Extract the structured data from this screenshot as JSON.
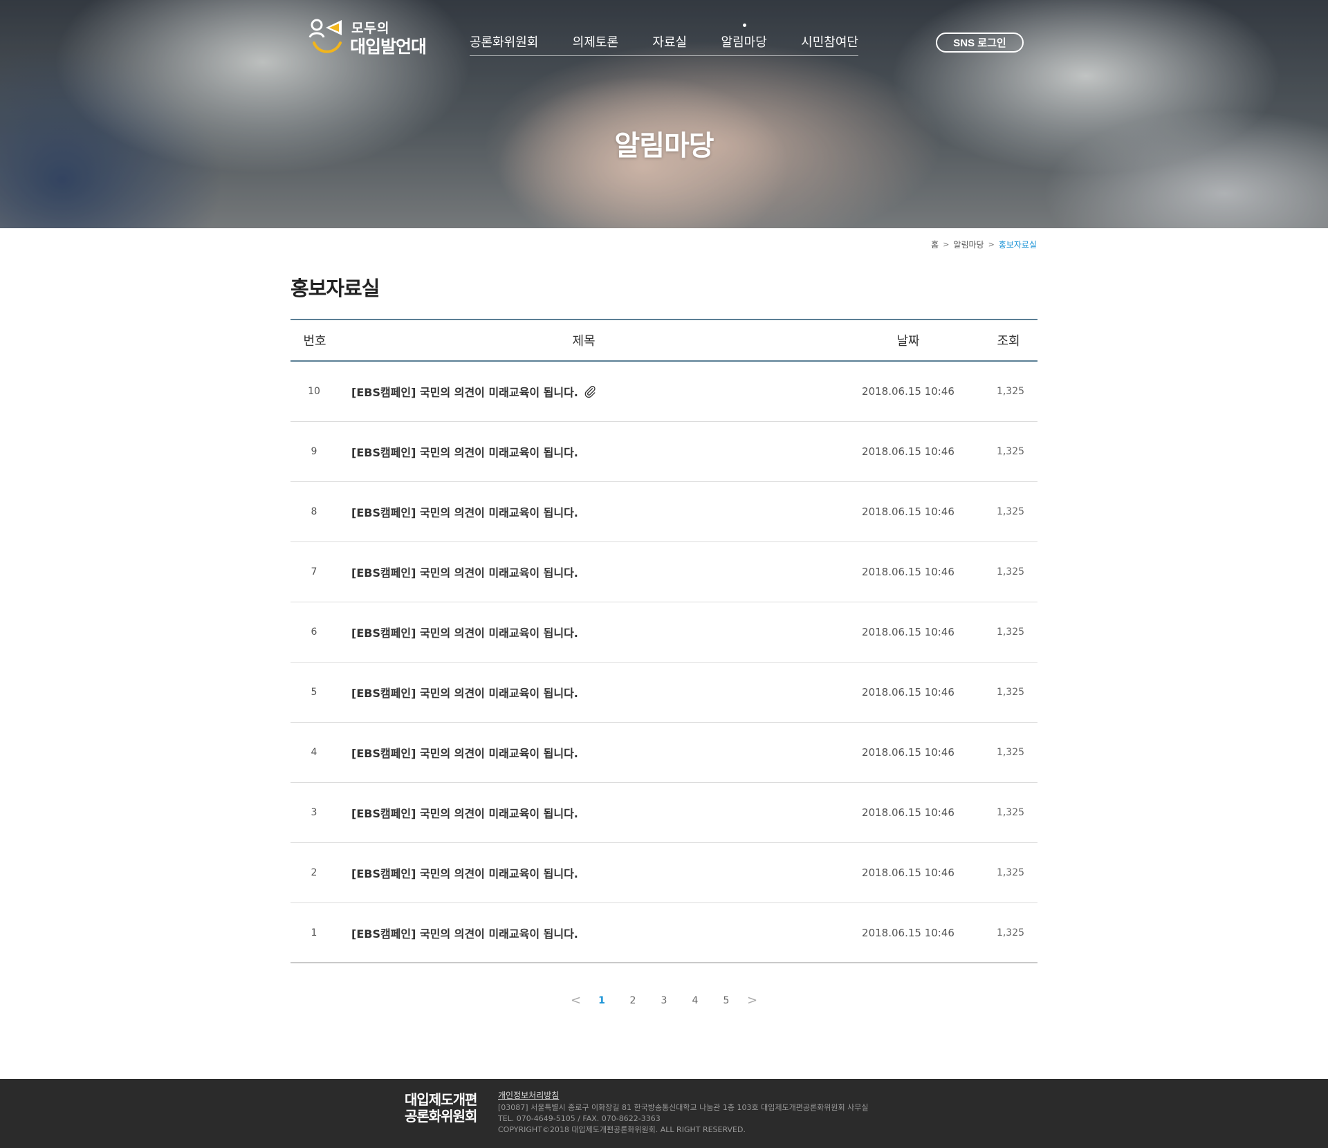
{
  "header": {
    "logo_top": "모두의",
    "logo_main": "대입발언대",
    "nav": [
      {
        "label": "공론화위원회",
        "active": false
      },
      {
        "label": "의제토론",
        "active": false
      },
      {
        "label": "자료실",
        "active": false
      },
      {
        "label": "알림마당",
        "active": true
      },
      {
        "label": "시민참여단",
        "active": false
      }
    ],
    "sns_login": "SNS 로그인",
    "hero_title": "알림마당"
  },
  "breadcrumb": {
    "home": "홈",
    "parent": "알림마당",
    "current": "홍보자료실"
  },
  "page_title": "홍보자료실",
  "board": {
    "columns": {
      "no": "번호",
      "title": "제목",
      "date": "날짜",
      "views": "조회"
    },
    "rows": [
      {
        "no": "10",
        "title": "[EBS캠페인] 국민의 의견이 미래교육이 됩니다.",
        "attachment": true,
        "date": "2018.06.15  10:46",
        "views": "1,325"
      },
      {
        "no": "9",
        "title": "[EBS캠페인] 국민의 의견이 미래교육이 됩니다.",
        "attachment": false,
        "date": "2018.06.15  10:46",
        "views": "1,325"
      },
      {
        "no": "8",
        "title": "[EBS캠페인] 국민의 의견이 미래교육이 됩니다.",
        "attachment": false,
        "date": "2018.06.15  10:46",
        "views": "1,325"
      },
      {
        "no": "7",
        "title": "[EBS캠페인] 국민의 의견이 미래교육이 됩니다.",
        "attachment": false,
        "date": "2018.06.15  10:46",
        "views": "1,325"
      },
      {
        "no": "6",
        "title": "[EBS캠페인] 국민의 의견이 미래교육이 됩니다.",
        "attachment": false,
        "date": "2018.06.15  10:46",
        "views": "1,325"
      },
      {
        "no": "5",
        "title": "[EBS캠페인] 국민의 의견이 미래교육이 됩니다.",
        "attachment": false,
        "date": "2018.06.15  10:46",
        "views": "1,325"
      },
      {
        "no": "4",
        "title": "[EBS캠페인] 국민의 의견이 미래교육이 됩니다.",
        "attachment": false,
        "date": "2018.06.15  10:46",
        "views": "1,325"
      },
      {
        "no": "3",
        "title": "[EBS캠페인] 국민의 의견이 미래교육이 됩니다.",
        "attachment": false,
        "date": "2018.06.15  10:46",
        "views": "1,325"
      },
      {
        "no": "2",
        "title": "[EBS캠페인] 국민의 의견이 미래교육이 됩니다.",
        "attachment": false,
        "date": "2018.06.15  10:46",
        "views": "1,325"
      },
      {
        "no": "1",
        "title": "[EBS캠페인] 국민의 의견이 미래교육이 됩니다.",
        "attachment": false,
        "date": "2018.06.15  10:46",
        "views": "1,325"
      }
    ]
  },
  "pagination": {
    "prev": "<",
    "next": ">",
    "pages": [
      "1",
      "2",
      "3",
      "4",
      "5"
    ],
    "current": "1"
  },
  "footer": {
    "logo_line1": "대입제도개편",
    "logo_line2": "공론화위원회",
    "privacy": "개인정보처리방침",
    "address": "[03087] 서울특별시 종로구 이화장길 81 한국방송통신대학교 나눔관 1층 103호 대입제도개편공론화위원회 사무실",
    "contact": "TEL. 070-4649-5105 / FAX. 070-8622-3363",
    "copyright": "COPYRIGHT©2018 대입제도개편공론화위원회. ALL RIGHT RESERVED."
  },
  "colors": {
    "accent": "#1a93d6",
    "table_border": "#5b7f95",
    "footer_bg": "#2b2b2b",
    "logo_yellow": "#f2b51c"
  }
}
